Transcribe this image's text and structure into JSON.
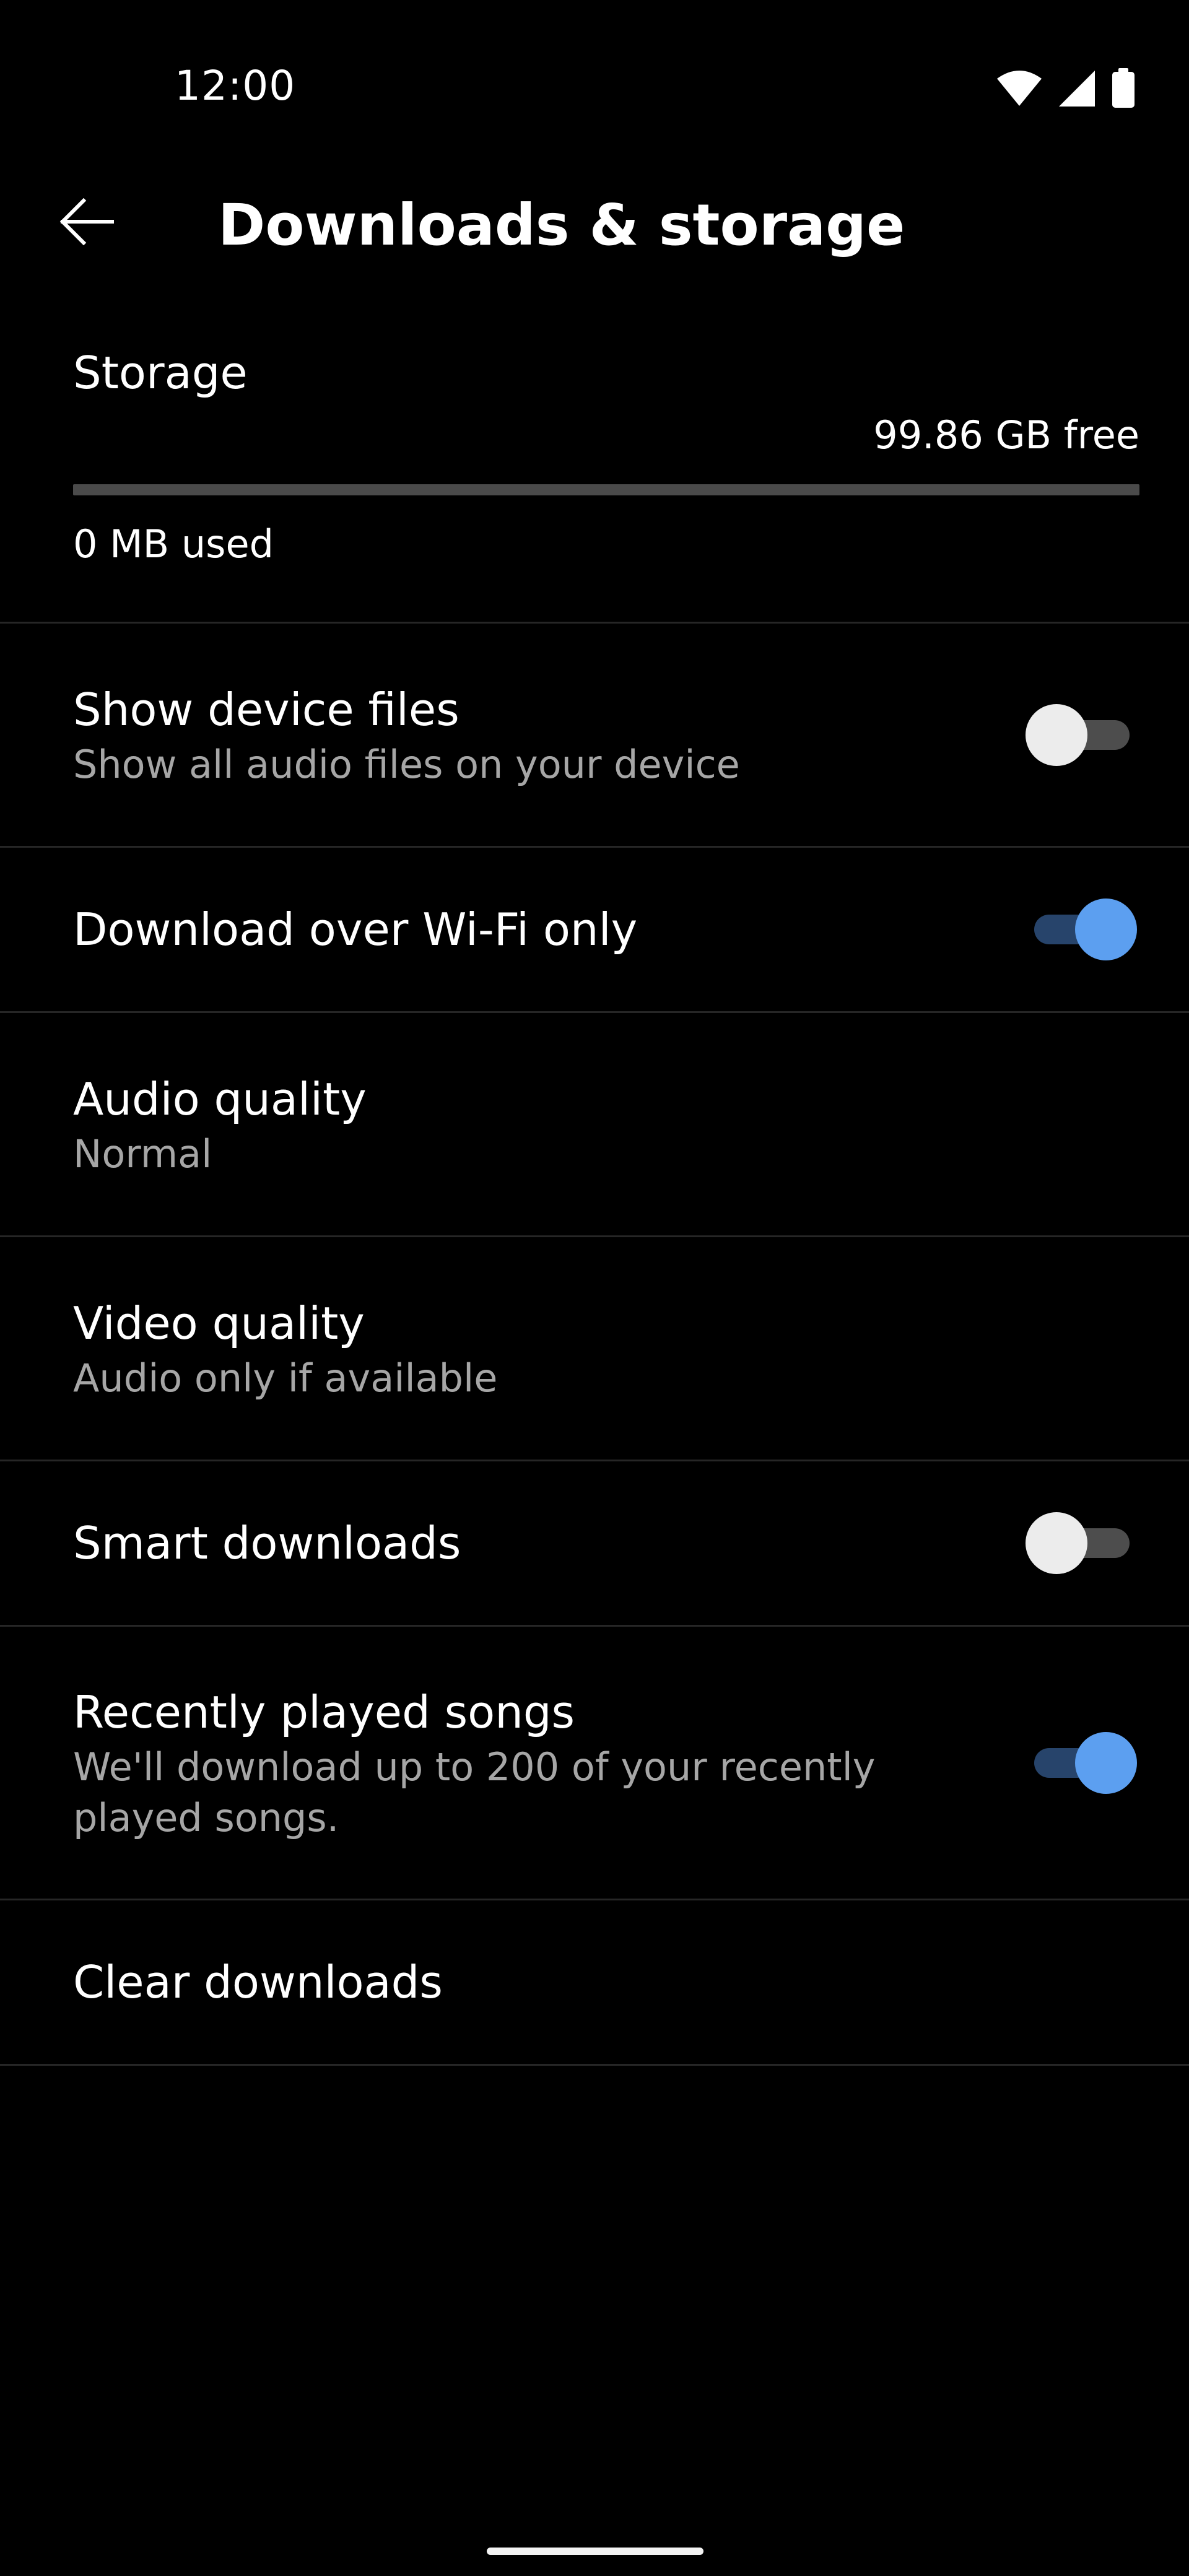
{
  "status_bar": {
    "time": "12:00",
    "icons": [
      "wifi-icon",
      "cellular-signal-icon",
      "battery-icon"
    ]
  },
  "app_bar": {
    "back_icon": "arrow-left-icon",
    "title": "Downloads & storage"
  },
  "storage": {
    "title": "Storage",
    "free": "99.86 GB free",
    "used": "0 MB used",
    "used_fraction": 0
  },
  "settings": [
    {
      "label": "Show device files",
      "sub": "Show all audio files on your device",
      "toggle": false
    },
    {
      "label": "Download over Wi-Fi only",
      "toggle": true
    },
    {
      "label": "Audio quality",
      "sub": "Normal"
    },
    {
      "label": "Video quality",
      "sub": "Audio only if available"
    },
    {
      "label": "Smart downloads",
      "toggle": false
    },
    {
      "label": "Recently played songs",
      "sub": "We'll download up to 200 of your recently played songs.",
      "toggle": true
    },
    {
      "label": "Clear downloads"
    }
  ],
  "colors": {
    "background": "#000000",
    "accent": "#5c9ff0",
    "secondary_text": "#a6a6a6",
    "divider": "#262626"
  }
}
